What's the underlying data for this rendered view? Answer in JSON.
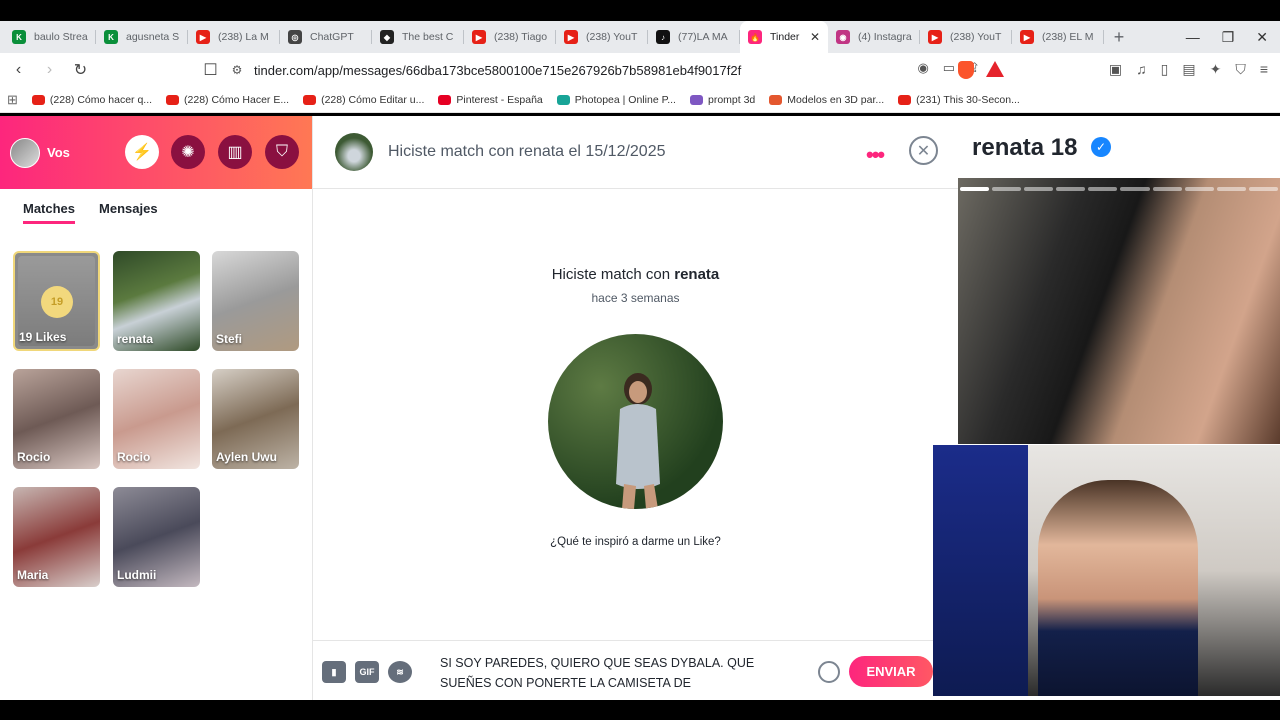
{
  "browser": {
    "tabs": [
      {
        "label": "baulo Strea",
        "color": "#0a8f3a",
        "glyph": "K"
      },
      {
        "label": "agusneta S",
        "color": "#0a8f3a",
        "glyph": "K"
      },
      {
        "label": "(238) La M",
        "color": "#e62117",
        "glyph": "▶"
      },
      {
        "label": "ChatGPT",
        "color": "#444444",
        "glyph": "◎"
      },
      {
        "label": "The best C",
        "color": "#222222",
        "glyph": "◆"
      },
      {
        "label": "(238) Tiago",
        "color": "#e62117",
        "glyph": "▶"
      },
      {
        "label": "(238) YouT",
        "color": "#e62117",
        "glyph": "▶"
      },
      {
        "label": "(77)LA MA",
        "color": "#111111",
        "glyph": "♪"
      },
      {
        "label": "Tinder",
        "color": "#fd267d",
        "glyph": "🔥",
        "active": true
      },
      {
        "label": "(4) Instagra",
        "color": "#c13584",
        "glyph": "◉"
      },
      {
        "label": "(238) YouT",
        "color": "#e62117",
        "glyph": "▶"
      },
      {
        "label": "(238) EL M",
        "color": "#e62117",
        "glyph": "▶"
      }
    ],
    "url": "tinder.com/app/messages/66dba173bce5800100e715e267926b7b58981eb4f9017f2f",
    "bookmarks": [
      {
        "label": "(228) Cómo hacer q...",
        "color": "#e62117"
      },
      {
        "label": "(228) Cómo Hacer E...",
        "color": "#e62117"
      },
      {
        "label": "(228) Cómo Editar u...",
        "color": "#e62117"
      },
      {
        "label": "Pinterest - España",
        "color": "#e60023"
      },
      {
        "label": "Photopea | Online P...",
        "color": "#18a497"
      },
      {
        "label": "prompt 3d",
        "color": "#7e57c2"
      },
      {
        "label": "Modelos en 3D par...",
        "color": "#e4572e"
      },
      {
        "label": "(231) This 30-Secon...",
        "color": "#e62117"
      }
    ]
  },
  "sidebar": {
    "user": "Vos",
    "tabs": [
      "Matches",
      "Mensajes"
    ],
    "likes": {
      "count": "19",
      "label": "19 Likes"
    },
    "matches": [
      "renata",
      "Stefi",
      "Rocio",
      "Rocio",
      "Aylen Uwu",
      "Maria",
      "Ludmii"
    ]
  },
  "chat": {
    "header_title": "Hiciste match con renata el 15/12/2025",
    "match_title_prefix": "Hiciste match con",
    "match_name": "renata",
    "match_ago": "hace 3 semanas",
    "question": "¿Qué te inspiró a darme un Like?",
    "composer_text": "SI SOY PAREDES, QUIERO QUE SEAS DYBALA. QUE SUEÑES CON PONERTE LA CAMISETA DE",
    "gif_label": "GIF",
    "send_label": "ENVIAR"
  },
  "profile": {
    "name": "renata",
    "age": "18"
  },
  "colors": {
    "brand_gradient_start": "#fd267d",
    "brand_gradient_end": "#ff7854"
  }
}
